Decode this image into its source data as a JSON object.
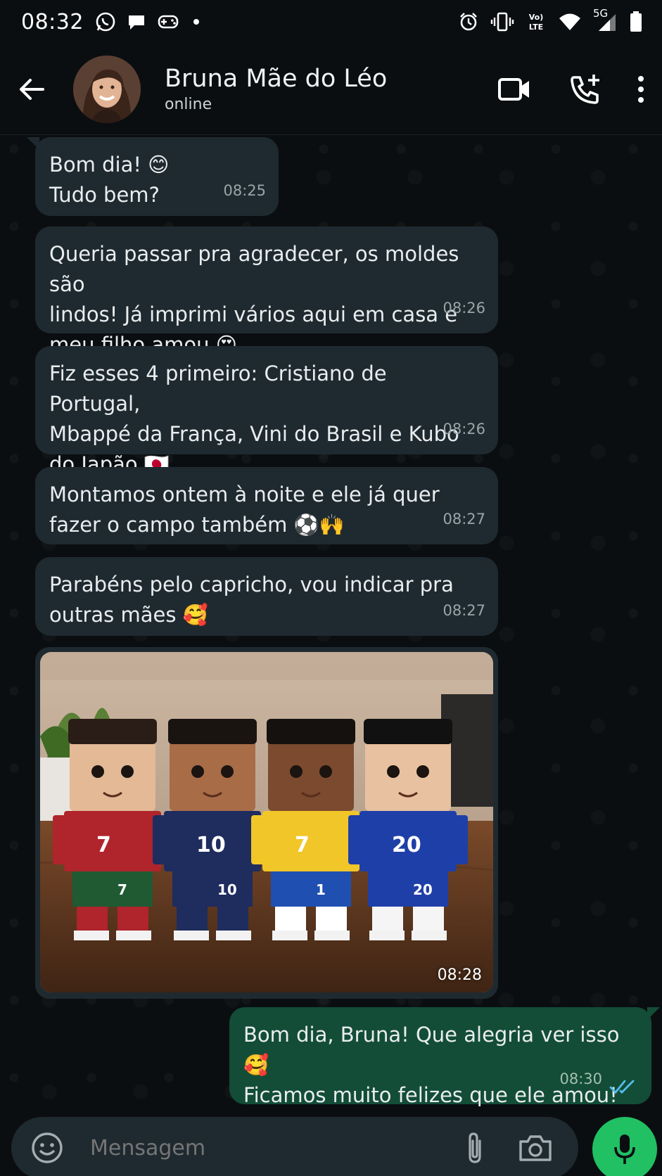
{
  "status_bar": {
    "time": "08:32",
    "network": "5G"
  },
  "header": {
    "contact_name": "Bruna Mãe do Léo",
    "contact_status": "online"
  },
  "messages": [
    {
      "direction": "in",
      "text": "Bom dia! 😊\nTudo bem?",
      "time": "08:25"
    },
    {
      "direction": "in",
      "text": "Queria passar pra agradecer, os moldes são\nlindos! Já imprimi vários aqui em casa e\nmeu filho amou 😍",
      "time": "08:26"
    },
    {
      "direction": "in",
      "text": "Fiz esses 4 primeiro: Cristiano de Portugal,\nMbappé da França, Vini do Brasil e Kubo\ndo Japão 🇯🇵",
      "time": "08:26"
    },
    {
      "direction": "in",
      "text": "Montamos ontem à noite e ele já quer\nfazer o campo também ⚽🙌",
      "time": "08:27"
    },
    {
      "direction": "in",
      "text": "Parabéns pelo capricho, vou indicar pra\noutras mães 🥰",
      "time": "08:27"
    },
    {
      "direction": "in",
      "type": "photo",
      "time": "08:28",
      "figures": [
        {
          "number": "7",
          "shirt": "#b0242b",
          "shorts": "#1f5a33",
          "socks": "#b0242b"
        },
        {
          "number": "10",
          "shirt": "#1e2c5e",
          "shorts": "#1e2c5e",
          "socks": "#1e2c5e"
        },
        {
          "number": "7",
          "shirt": "#f1c629",
          "shorts": "#1f4fb1",
          "socks": "#ffffff"
        },
        {
          "number": "20",
          "shirt": "#1f3fa8",
          "shorts": "#1f3fa8",
          "socks": "#f5f5f5"
        }
      ],
      "short_numbers": [
        "7",
        "10",
        "1",
        "20"
      ]
    },
    {
      "direction": "out",
      "text": "Bom dia, Bruna! Que alegria ver isso 🥰\nFicamos muito felizes que ele amou!",
      "time": "08:30"
    }
  ],
  "input": {
    "placeholder": "Mensagem"
  },
  "colors": {
    "background": "#0b0e10",
    "incoming_bubble": "#1f2a30",
    "outgoing_bubble": "#134d37",
    "mic_button": "#21c063",
    "read_ticks": "#53bdeb"
  }
}
